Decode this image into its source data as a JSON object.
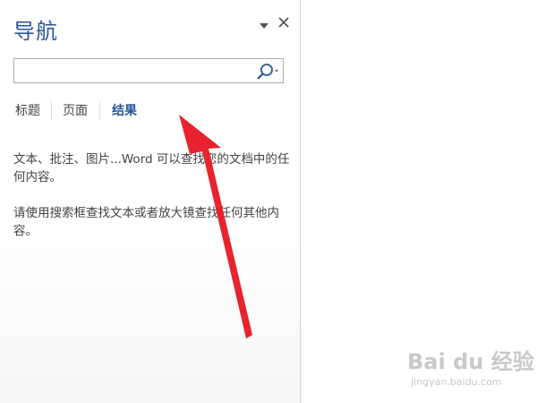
{
  "nav_pane": {
    "title": "导航",
    "search": {
      "value": "",
      "placeholder": ""
    },
    "tabs": [
      {
        "label": "标题",
        "active": false
      },
      {
        "label": "页面",
        "active": false
      },
      {
        "label": "结果",
        "active": true
      }
    ],
    "results_message": {
      "paragraph1": "文本、批注、图片...Word 可以查找您的文档中的任何内容。",
      "paragraph2": "请使用搜索框查找文本或者放大镜查找任何其他内容。"
    }
  },
  "watermark": {
    "main": "Bai du 经验",
    "sub": "jingyan.baidu.com"
  },
  "colors": {
    "accent": "#2b579a",
    "arrow": "#e8232e",
    "text": "#444444"
  },
  "icons": {
    "pane_dropdown": "triangle-down-icon",
    "pane_close": "close-icon",
    "search": "magnifier-icon",
    "search_dropdown": "chevron-down-icon"
  }
}
